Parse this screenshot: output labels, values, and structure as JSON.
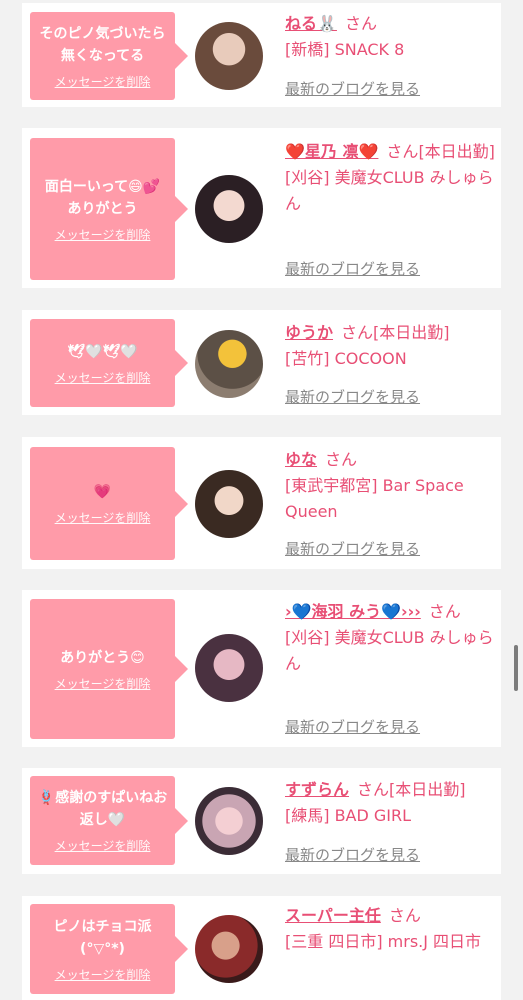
{
  "delete_label": "メッセージを削除",
  "blog_label": "最新のブログを見る",
  "honorific": "さん",
  "colors": {
    "accent": "#e84f75",
    "bubble": "#ff9ba9",
    "link_gray": "#888888"
  },
  "messages": [
    {
      "text": "そのピノ気づいたら無くなってる",
      "name": "ねる🐰",
      "suffix": "",
      "shop": "[新橋] SNACK 8"
    },
    {
      "text": "面白ーいって😄💕ありがとう",
      "name": "❤️星乃 凛❤️",
      "suffix": "[本日出勤]",
      "shop": "[刈谷] 美魔女CLUB みしゅらん"
    },
    {
      "text": "🕊🤍🕊🤍",
      "name": "ゆうか",
      "suffix": "[本日出勤]",
      "shop": "[苫竹] COCOON"
    },
    {
      "text": "💗",
      "name": "ゆな",
      "suffix": "",
      "shop": "[東武宇都宮] Bar Space Queen"
    },
    {
      "text": "ありがとう😊",
      "name": "›💙海羽 みう💙›››",
      "suffix": "",
      "shop": "[刈谷] 美魔女CLUB みしゅらん"
    },
    {
      "text": "🪢感謝のすぱいねお返し🤍",
      "name": "すずらん",
      "suffix": "[本日出勤]",
      "shop": "[練馬] BAD GIRL"
    },
    {
      "text": "ピノはチョコ派(°▽°*)",
      "name": "スーパー主任",
      "suffix": "",
      "shop": "[三重 四日市] mrs.J 四日市"
    }
  ]
}
